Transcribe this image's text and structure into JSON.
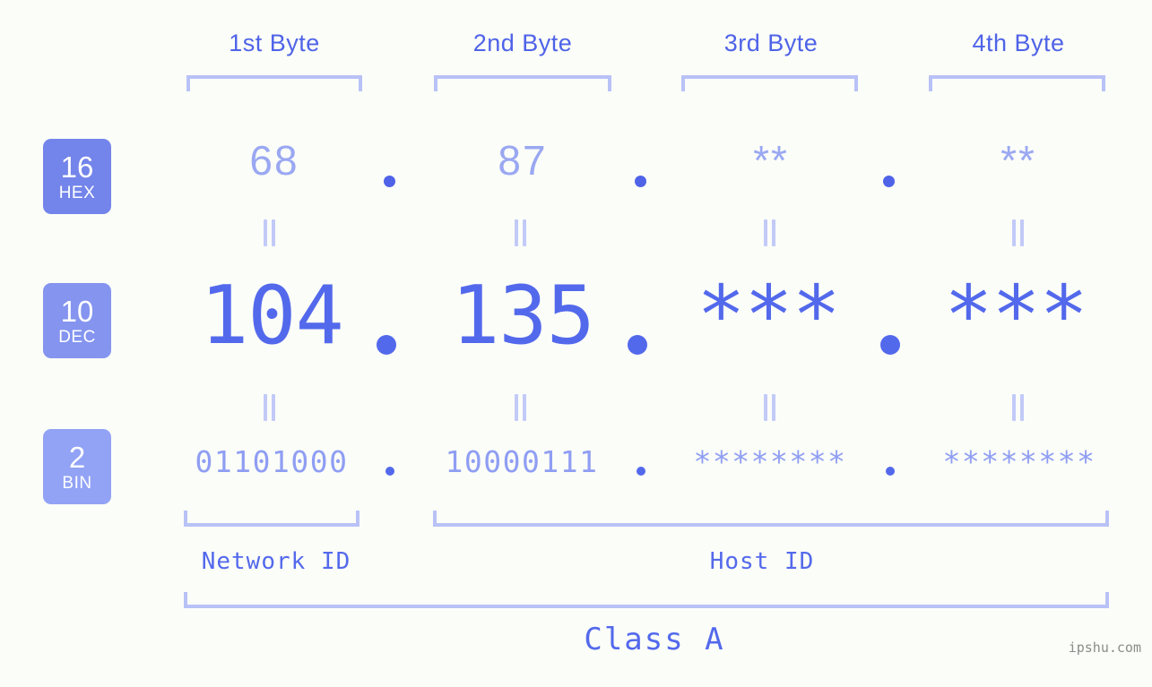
{
  "background_color": "#fbfdf8",
  "accent_color": "#5369ec",
  "muted_accent_color": "#b8c2f7",
  "byte_headers": [
    {
      "label": "1st Byte"
    },
    {
      "label": "2nd Byte"
    },
    {
      "label": "3rd Byte"
    },
    {
      "label": "4th Byte"
    }
  ],
  "bases": [
    {
      "number": "16",
      "name": "HEX",
      "color": "#7384ea"
    },
    {
      "number": "10",
      "name": "DEC",
      "color": "#8494ef"
    },
    {
      "number": "2",
      "name": "BIN",
      "color": "#92a2f5"
    }
  ],
  "rows": {
    "hex": {
      "values": [
        "68",
        "87",
        "**",
        "**"
      ],
      "separator": "."
    },
    "dec": {
      "values": [
        "104",
        "135",
        "***",
        "***"
      ],
      "separator": "."
    },
    "bin": {
      "values": [
        "01101000",
        "10000111",
        "********",
        "********"
      ],
      "separator": "."
    }
  },
  "connectors": {
    "symbol": "="
  },
  "segments": {
    "network_id": "Network ID",
    "host_id": "Host ID",
    "class": "Class A"
  },
  "watermark": "ipshu.com"
}
